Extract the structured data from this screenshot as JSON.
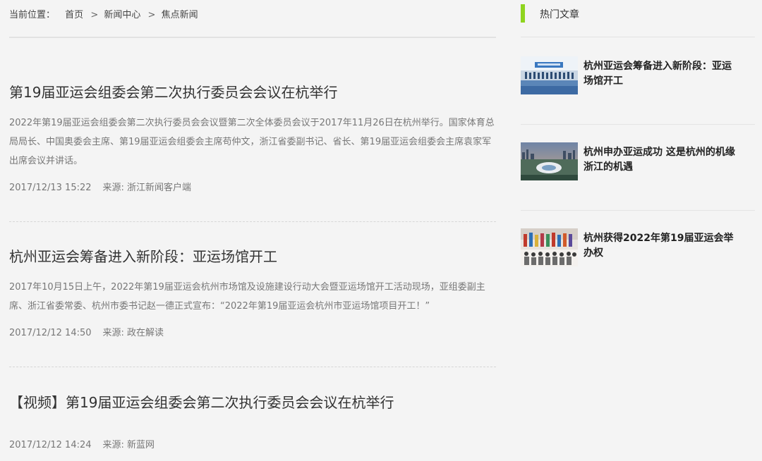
{
  "breadcrumb": {
    "prefix": "当前位置：",
    "items": [
      "首页",
      "新闻中心",
      "焦点新闻"
    ],
    "separator": ">"
  },
  "articles": [
    {
      "title": "第19届亚运会组委会第二次执行委员会会议在杭举行",
      "summary": "2022年第19届亚运会组委会第二次执行委员会会议暨第二次全体委员会议于2017年11月26日在杭州举行。国家体育总局局长、中国奥委会主席、第19届亚运会组委会主席苟仲文，浙江省委副书记、省长、第19届亚运会组委会主席袁家军出席会议并讲话。",
      "date": "2017/12/13 15:22",
      "source": "来源: 浙江新闻客户端"
    },
    {
      "title": "杭州亚运会筹备进入新阶段：亚运场馆开工",
      "summary": "2017年10月15日上午，2022年第19届亚运会杭州市场馆及设施建设行动大会暨亚运场馆开工活动现场，亚组委副主席、浙江省委常委、杭州市委书记赵一德正式宣布：“2022年第19届亚运会杭州市亚运场馆项目开工！”",
      "date": "2017/12/12 14:50",
      "source": "来源: 政在解读"
    },
    {
      "title": "【视频】第19届亚运会组委会第二次执行委员会会议在杭举行",
      "summary": "",
      "date": "2017/12/12 14:24",
      "source": "来源: 新蓝网"
    }
  ],
  "sidebar": {
    "heading": "热门文章",
    "accent_color": "#8fd41f",
    "items": [
      {
        "title": "杭州亚运会筹备进入新阶段：亚运场馆开工",
        "thumb": "stage-photo"
      },
      {
        "title": "杭州申办亚运成功 这是杭州的机缘 浙江的机遇",
        "thumb": "stadium-aerial-photo"
      },
      {
        "title": "杭州获得2022年第19届亚运会举办权",
        "thumb": "ceremony-photo"
      }
    ]
  }
}
